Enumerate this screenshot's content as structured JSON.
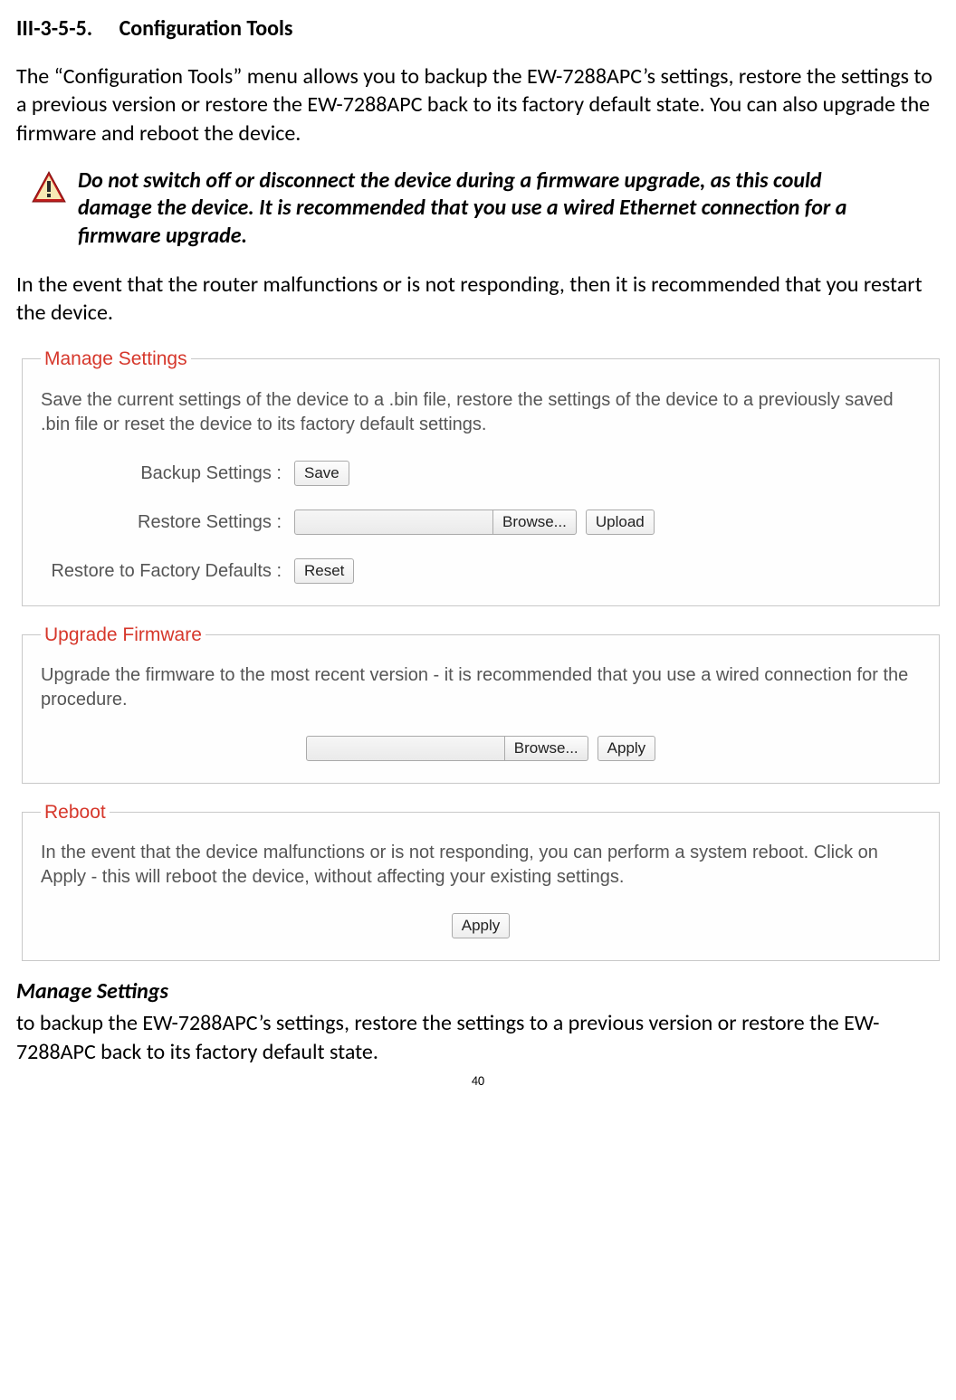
{
  "heading": {
    "number": "III-3-5-5.",
    "title": "Configuration Tools"
  },
  "intro_paragraph": "The “Configuration Tools” menu allows you to backup the EW-7288APC’s settings, restore the settings to a previous version or restore the EW-7288APC back to its factory default state. You can also upgrade the firmware and reboot the device.",
  "warning_text": "Do not switch off or disconnect the device during a firmware upgrade, as this could damage the device. It is recommended that you use a wired Ethernet connection for a firmware upgrade.",
  "post_warning_paragraph": "In the event that the router malfunctions or is not responding, then it is recommended that you restart the device.",
  "panels": {
    "manage": {
      "legend": "Manage Settings",
      "description": "Save the current settings of the device to a .bin file, restore the settings of the device to a previously saved .bin file or reset the device to its factory default settings.",
      "backup_label": "Backup Settings :",
      "backup_button": "Save",
      "restore_label": "Restore Settings :",
      "restore_browse": "Browse...",
      "restore_upload": "Upload",
      "factory_label": "Restore to Factory Defaults :",
      "factory_button": "Reset"
    },
    "upgrade": {
      "legend": "Upgrade Firmware",
      "description": "Upgrade the firmware to the most recent version - it is recommended that you use a wired connection for the procedure.",
      "browse": "Browse...",
      "apply": "Apply"
    },
    "reboot": {
      "legend": "Reboot",
      "description": "In the event that the device malfunctions or is not responding, you can perform a system reboot. Click on Apply - this will reboot the device, without affecting your existing settings.",
      "apply": "Apply"
    }
  },
  "sub_section": {
    "title": "Manage Settings",
    "body": "to backup the EW-7288APC’s settings, restore the settings to a previous version or restore the EW-7288APC back to its factory default state."
  },
  "page_number": "40"
}
